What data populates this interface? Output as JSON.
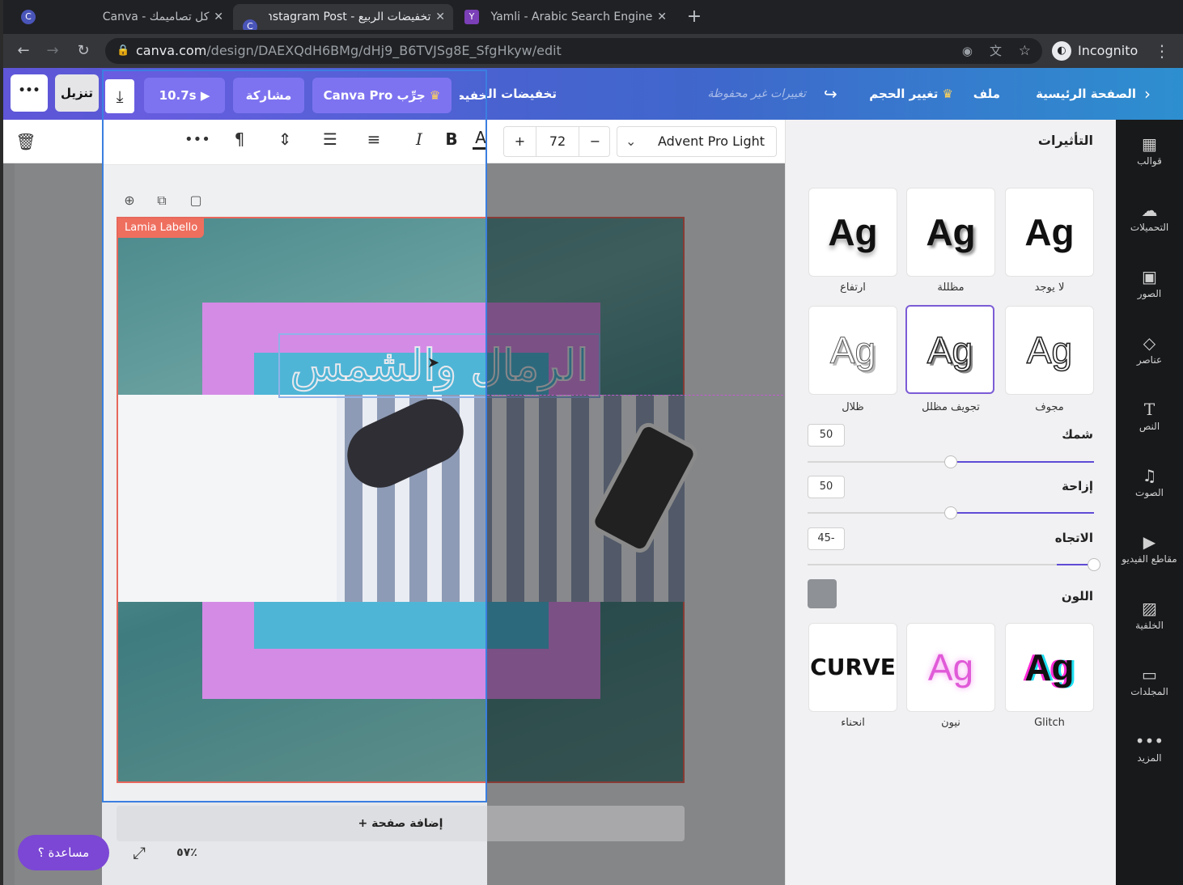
{
  "browser": {
    "tabs": [
      {
        "title": "كل تصاميمك - Canva",
        "favicon": "C"
      },
      {
        "title": "تخفيضات الربيع - Instagram Post",
        "favicon": "C"
      },
      {
        "title": "Yamli - Arabic Search Engine",
        "favicon": "Y"
      }
    ],
    "url_host": "canva.com",
    "url_path": "/design/DAEXQdH6BMg/dHj9_B6TVJSg8E_SfgHkyw/edit",
    "profile": "Incognito",
    "new_tab": "+"
  },
  "header": {
    "home": "الصفحة الرئيسية",
    "file": "ملف",
    "resize": "تغيير الحجم",
    "unsaved": "تغييرات غير محفوظة",
    "design_title": "تخفيضات الربيع",
    "try_pro": "جرِّب Canva Pro",
    "share": "مشاركة",
    "duration": "10.7s",
    "download": "تنزيل",
    "more": "•••"
  },
  "toolbar": {
    "font_name": "Advent Pro Light",
    "font_size": "72",
    "minus": "−",
    "plus": "+",
    "bold": "B",
    "italic": "I",
    "more": "•••"
  },
  "effects_panel": {
    "title": "التأثيرات",
    "styles": [
      {
        "label": "لا يوجد",
        "sample": "Ag"
      },
      {
        "label": "مظللة",
        "sample": "Ag"
      },
      {
        "label": "ارتفاع",
        "sample": "Ag"
      },
      {
        "label": "مجوف",
        "sample": "Ag"
      },
      {
        "label": "تجويف مظلل",
        "sample": "Ag"
      },
      {
        "label": "ظلال",
        "sample": "Ag"
      },
      {
        "label": "Glitch",
        "sample": "Ag"
      },
      {
        "label": "نيون",
        "sample": "Ag"
      },
      {
        "label": "انحناء",
        "sample": "CURVE"
      }
    ],
    "thickness_label": "شمك",
    "thickness_value": "50",
    "offset_label": "إزاحة",
    "offset_value": "50",
    "direction_label": "الاتجاه",
    "direction_value": "45-",
    "color_label": "اللون",
    "shadow_color": "#8e9196",
    "thickness_level": 0.5,
    "offset_level": 0.5,
    "direction_level": 0.13
  },
  "sidenav": [
    {
      "label": "قوالب",
      "icon": "templates-icon"
    },
    {
      "label": "التحميلات",
      "icon": "upload-icon"
    },
    {
      "label": "الصور",
      "icon": "photos-icon"
    },
    {
      "label": "عناصر",
      "icon": "elements-icon"
    },
    {
      "label": "النص",
      "icon": "text-icon"
    },
    {
      "label": "الصوت",
      "icon": "audio-icon"
    },
    {
      "label": "مقاطع الفيديو",
      "icon": "video-icon"
    },
    {
      "label": "الخلفية",
      "icon": "background-icon"
    },
    {
      "label": "المجلدات",
      "icon": "folder-icon"
    },
    {
      "label": "المزيد",
      "icon": "more-icon"
    }
  ],
  "canvas": {
    "headline": "الرمال والشمس",
    "collaborator": "Lamia Labello",
    "add_page": "+ إضافة صفحة",
    "zoom": "٥٧٪",
    "help": "مساعدة ؟"
  },
  "colors": {
    "accent": "#7c5cd6",
    "pink_box": "#d48be6",
    "cyan_box": "#4fb5d6",
    "collaborator_tag": "#ef6f5f"
  }
}
